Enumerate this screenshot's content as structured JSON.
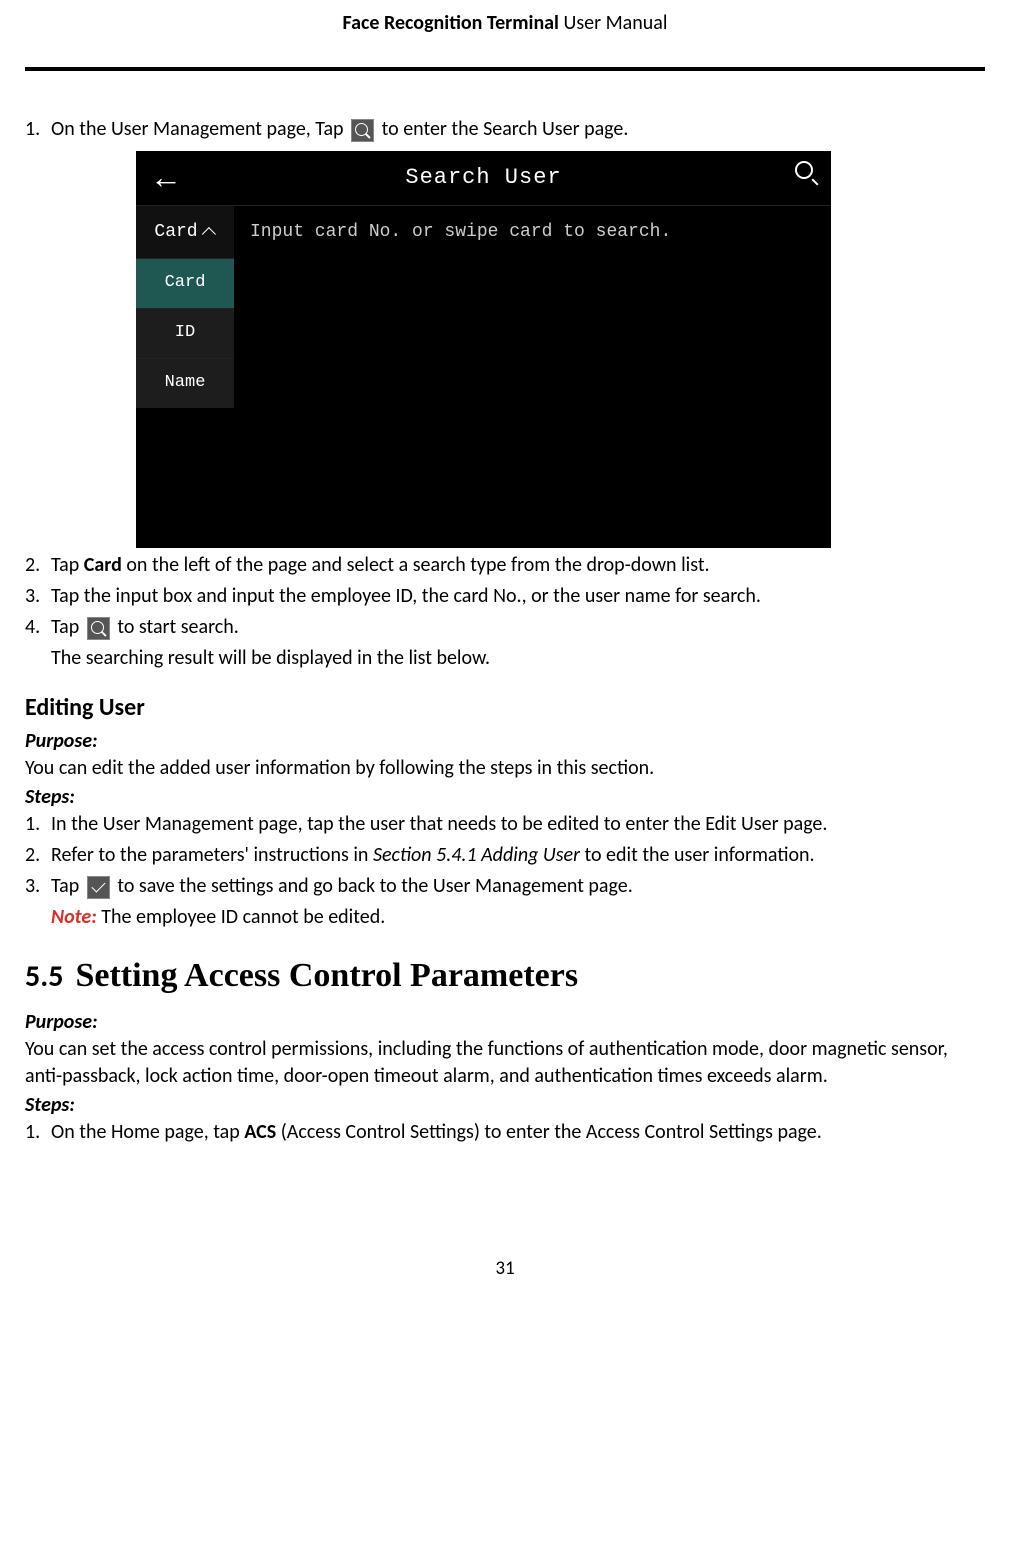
{
  "header": {
    "title_bold": "Face Recognition Terminal",
    "title_rest": "  User Manual"
  },
  "list1": {
    "item1_pre": "On the User Management page, Tap ",
    "item1_post": " to enter the Search User page.",
    "item2_pre": "Tap ",
    "item2_bold": "Card",
    "item2_post": " on the left of the page and select a search type from the drop-down list.",
    "item3": "Tap the input box and input the employee ID, the card No., or the user name for search.",
    "item4_pre": "Tap ",
    "item4_post": " to start search.",
    "item4_note": "The searching result will be displayed in the list below."
  },
  "screenshot": {
    "title": "Search User",
    "dropdown_label": "Card",
    "input_hint": "Input card No. or swipe card to search.",
    "options": [
      "Card",
      "ID",
      "Name"
    ]
  },
  "editing_user": {
    "heading": "Editing User",
    "purpose_label": "Purpose:",
    "purpose_text": "You can edit the added user information by following the steps in this section.",
    "steps_label": "Steps:",
    "step1": "In the User Management page, tap the user that needs to be edited to enter the Edit User page.",
    "step2_pre": "Refer to the parameters' instructions in ",
    "step2_italic": "Section 5.4.1 Adding User",
    "step2_post": " to edit the user information.",
    "step3_pre": "Tap ",
    "step3_post": " to save the settings and go back to the User Management page.",
    "note_label": "Note:",
    "note_text": " The employee ID cannot be edited."
  },
  "section_5_5": {
    "num": "5.5",
    "title": "Setting Access Control Parameters",
    "purpose_label": "Purpose:",
    "purpose_text": "You can set the access control permissions, including the functions of authentication mode, door magnetic sensor, anti-passback, lock action time, door-open timeout alarm, and authentication times exceeds alarm.",
    "steps_label": "Steps:",
    "step1_pre": "On the Home page, tap ",
    "step1_bold": "ACS",
    "step1_post": " (Access Control Settings) to enter the Access Control Settings page."
  },
  "page_number": "31"
}
